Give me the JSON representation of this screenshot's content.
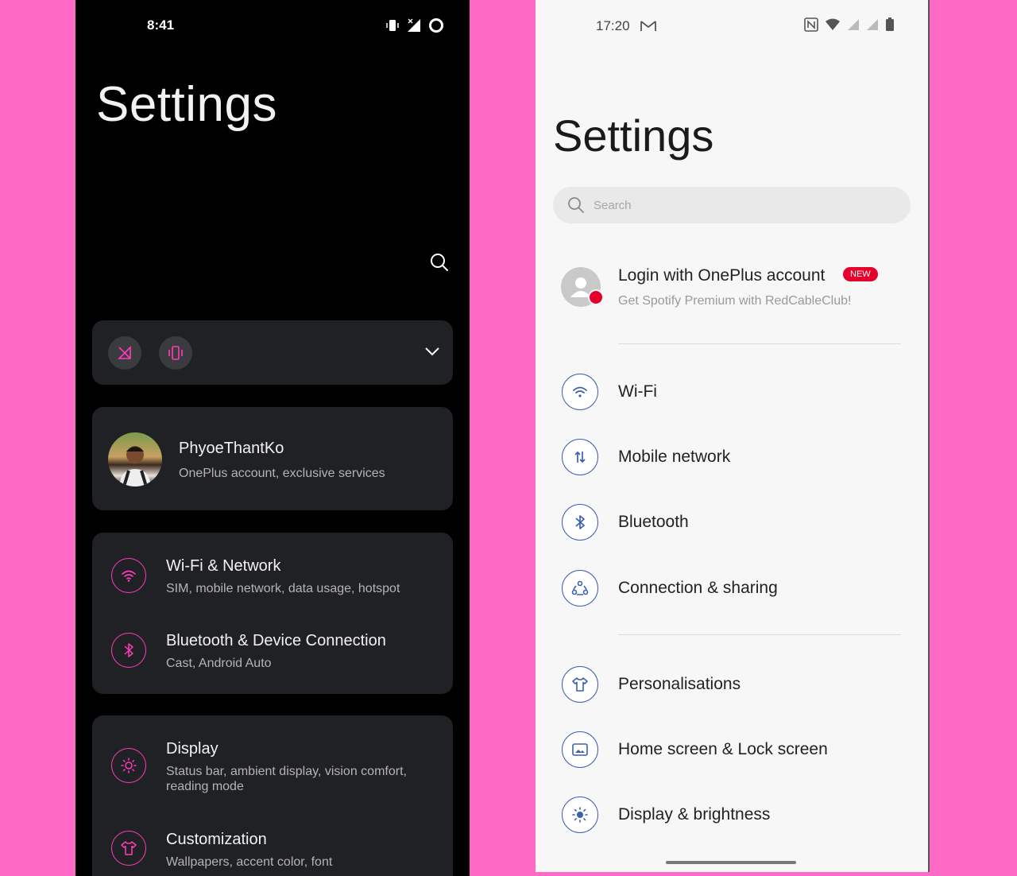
{
  "colors": {
    "background": "#fe6ac6",
    "dark_accent": "#ff3cb9",
    "light_accent": "#3d5fb0",
    "new_badge": "#e5002b"
  },
  "dark": {
    "time": "8:41",
    "title": "Settings",
    "account": {
      "name": "PhyoeThantKo",
      "subtitle": "OnePlus account, exclusive services"
    },
    "network_items": [
      {
        "icon": "wifi-icon",
        "title": "Wi-Fi & Network",
        "subtitle": "SIM, mobile network, data usage, hotspot"
      },
      {
        "icon": "bluetooth-icon",
        "title": "Bluetooth & Device Connection",
        "subtitle": "Cast, Android Auto"
      }
    ],
    "display_items": [
      {
        "icon": "brightness-icon",
        "title": "Display",
        "subtitle": "Status bar, ambient display, vision comfort, reading mode"
      },
      {
        "icon": "shirt-icon",
        "title": "Customization",
        "subtitle": "Wallpapers, accent color, font"
      }
    ]
  },
  "light": {
    "time": "17:20",
    "title": "Settings",
    "search_placeholder": "Search",
    "login": {
      "title": "Login with OnePlus account",
      "badge": "NEW",
      "subtitle": "Get Spotify Premium with RedCableClub!"
    },
    "items": [
      {
        "icon": "wifi-icon",
        "label": "Wi-Fi"
      },
      {
        "icon": "mobile-network-icon",
        "label": "Mobile network"
      },
      {
        "icon": "bluetooth-icon",
        "label": "Bluetooth"
      },
      {
        "icon": "connection-sharing-icon",
        "label": "Connection & sharing"
      },
      {
        "icon": "shirt-icon",
        "label": "Personalisations"
      },
      {
        "icon": "home-screen-icon",
        "label": "Home screen & Lock screen"
      },
      {
        "icon": "brightness-icon",
        "label": "Display & brightness"
      }
    ]
  }
}
